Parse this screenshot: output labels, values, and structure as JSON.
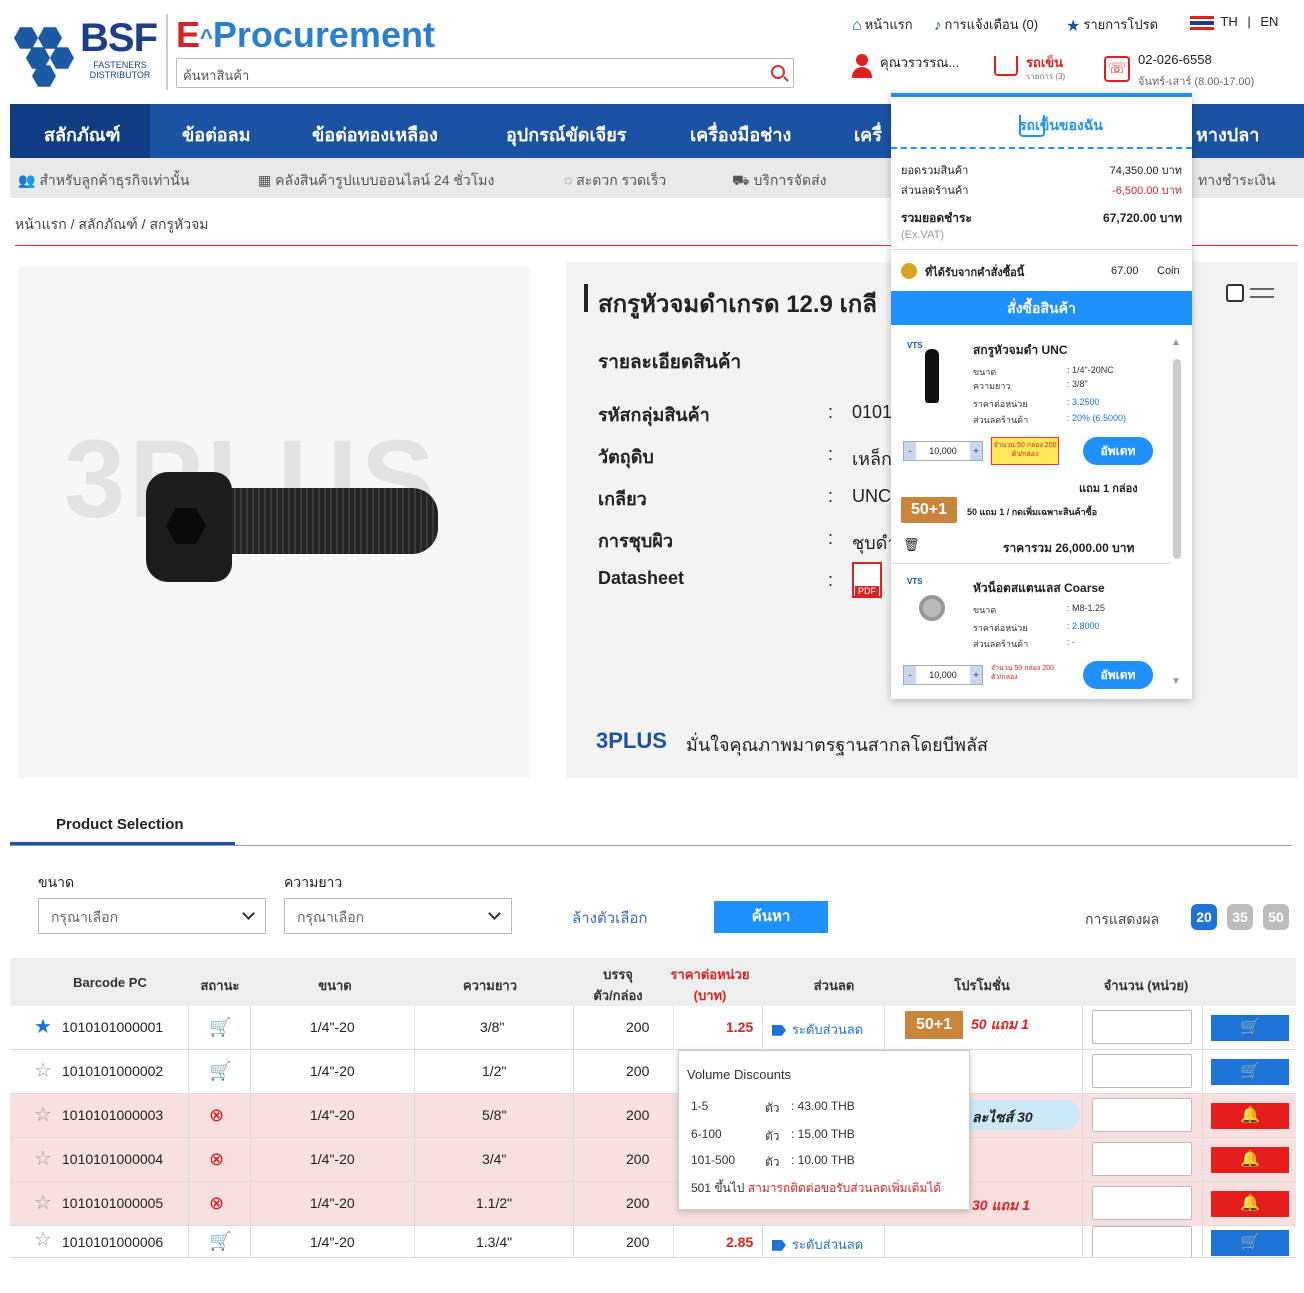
{
  "brand": {
    "logo_text": "BSF",
    "logo_sub_line1": "FASTENERS",
    "logo_sub_line2": "DISTRIBUTOR",
    "e_letter": "E",
    "procurement": "Procurement"
  },
  "search": {
    "placeholder": "ค้นหาสินค้า"
  },
  "topnav": {
    "home": "หน้าแรก",
    "notifications": "การแจ้งเตือน (0)",
    "favorites": "รายการโปรด",
    "lang_th": "TH",
    "lang_sep": "|",
    "lang_en": "EN",
    "user_name": "คุณวรวรรณ...",
    "cart_label": "รถเข็น",
    "cart_sub": "รายการ (3)",
    "phone": "02-026-6558",
    "hours": "จันทร์-เสาร์ (8.00-17.00)"
  },
  "navbar": {
    "items": [
      "สลักภัณฑ์",
      "ข้อต่อลม",
      "ข้อต่อทองเหลือง",
      "อุปกรณ์ขัดเจียร",
      "เครื่องมือช่าง",
      "เครื่",
      "หางปลา"
    ]
  },
  "subbar": {
    "items": [
      "สำหรับลูกค้าธุรกิจเท่านั้น",
      "คลังสินค้ารูปแบบออนไลน์ 24 ชั่วโมง",
      "สะดวก รวดเร็ว",
      "บริการจัดส่ง",
      "ทางชำระเงิน"
    ]
  },
  "breadcrumb": "หน้าแรก / สลักภัณฑ์ / สกรูหัวจม",
  "product": {
    "watermark": "3PLUS",
    "title": "สกรูหัวจมดำเกรด 12.9 เกลี",
    "detail_heading": "รายละเอียดสินค้า",
    "specs": [
      {
        "label": "รหัสกลุ่มสินค้า",
        "value": "0101"
      },
      {
        "label": "วัตถุดิบ",
        "value": "เหล็ก"
      },
      {
        "label": "เกลียว",
        "value": "UNC"
      },
      {
        "label": "การชุบผิว",
        "value": "ชุบดำ"
      },
      {
        "label": "Datasheet",
        "value": ""
      }
    ],
    "colon": ":",
    "bplus_logo": "3PLUS",
    "bplus_text": "มั่นใจคุณภาพมาตรฐานสากลโดยบีพลัส"
  },
  "cart_dropdown": {
    "title": "รถเข็นของฉัน",
    "subtotal_label": "ยอดรวมสินค้า",
    "subtotal_value": "74,350.00 บาท",
    "discount_label": "ส่วนลดร้านค้า",
    "discount_value": "-6,500.00 บาท",
    "total_label": "รวมยอดชำระ",
    "total_value": "67,720.00 บาท",
    "exvat": "(Ex.VAT)",
    "coin_label": "ที่ได้รับจากคำสั่งซื้อนี้",
    "coin_value": "67.00",
    "coin_unit": "Coin",
    "order_button": "สั่งซื้อสินค้า",
    "items": [
      {
        "brand": "VTS",
        "name": "สกรูหัวจมดำ UNC",
        "size_label": "ขนาด",
        "size_value": ": 1/4\"-20NC",
        "length_label": "ความยาว",
        "length_value": ": 3/8\"",
        "unit_price_label": "ราคาต่อหน่วย",
        "unit_price_value": ": 3.2500",
        "store_disc_label": "ส่วนลดร้านค้า",
        "store_disc_value": ": 20% (6.5000)",
        "qty": "10,000",
        "qty_minus": "-",
        "qty_plus": "+",
        "qty_note": "จำนวน 50 กล่อง 200 ตัว/กล่อง",
        "update_button": "อัพเดท",
        "free_text": "แถม 1 กล่อง",
        "promo_badge": "50+1",
        "promo_text": "50 แถม 1 / กดเพิ่มเฉพาะสินค้าซื้อ",
        "line_total": "ราคารวม 26,000.00 บาท"
      },
      {
        "brand": "VTS",
        "name": "หัวน็อตสแตนเลส Coarse",
        "size_label": "ขนาด",
        "size_value": ": M8-1.25",
        "unit_price_label": "ราคาต่อหน่วย",
        "unit_price_value": ": 2.8000",
        "store_disc_label": "ส่วนลดร้านค้า",
        "store_disc_value": ": -",
        "qty": "10,000",
        "qty_minus": "-",
        "qty_plus": "+",
        "qty_note": "จำนวน 50 กล่อง 200 ตัว/กล่อง",
        "update_button": "อัพเดท"
      }
    ]
  },
  "selection": {
    "tab": "Product Selection",
    "size_label": "ขนาด",
    "length_label": "ความยาว",
    "select_placeholder": "กรุณาเลือก",
    "clear": "ล้างตัวเลือก",
    "search": "ค้นหา",
    "show_label": "การแสดงผล",
    "page_sizes": [
      "20",
      "35",
      "50"
    ]
  },
  "table": {
    "headers": {
      "barcode": "Barcode PC",
      "status": "สถานะ",
      "size": "ขนาด",
      "length": "ความยาว",
      "pack_1": "บรรจุ",
      "pack_2": "ตัว/กล่อง",
      "price_1": "ราคาต่อหน่วย",
      "price_2": "(บาท)",
      "discount": "ส่วนลด",
      "promo": "โปรโมชั่น",
      "qty": "จำนวน (หน่วย)"
    },
    "rows": [
      {
        "barcode": "1010101000001",
        "size": "1/4\"-20",
        "length": "3/8\"",
        "pack": "200",
        "price": "1.25",
        "discount": "ระดับส่วนลด",
        "promo_badge": "50+1",
        "promo": "50 แถม 1"
      },
      {
        "barcode": "1010101000002",
        "size": "1/4\"-20",
        "length": "1/2\"",
        "pack": "200",
        "price": "",
        "discount": "",
        "promo_badge": "",
        "promo": ""
      },
      {
        "barcode": "1010101000003",
        "size": "1/4\"-20",
        "length": "5/8\"",
        "pack": "200",
        "price": "",
        "discount": "",
        "promo_badge": "",
        "promo": "ละไซส์ 30"
      },
      {
        "barcode": "1010101000004",
        "size": "1/4\"-20",
        "length": "3/4\"",
        "pack": "200",
        "price": "",
        "discount": "",
        "promo_badge": "",
        "promo": ""
      },
      {
        "barcode": "1010101000005",
        "size": "1/4\"-20",
        "length": "1.1/2\"",
        "pack": "200",
        "price": "",
        "discount": "",
        "promo_badge": "",
        "promo": "30 แถม 1"
      },
      {
        "barcode": "1010101000006",
        "size": "1/4\"-20",
        "length": "1.3/4\"",
        "pack": "200",
        "price": "2.85",
        "discount": "ระดับส่วนลด",
        "promo_badge": "",
        "promo": ""
      }
    ],
    "volume_popup": {
      "title": "Volume Discounts",
      "unit": "ตัว",
      "tiers": [
        {
          "range": "1-5",
          "price": ": 43.00 THB"
        },
        {
          "range": "6-100",
          "price": ": 15.00 THB"
        },
        {
          "range": "101-500",
          "price": ": 10.00 THB"
        }
      ],
      "note_prefix": "501 ขึ้นไป",
      "note_link": "สามารถติดต่อขอรับส่วนลดเพิ่มเติมได้"
    }
  },
  "colors": {
    "primary": "#1b52a3",
    "accent": "#1e90ff",
    "danger": "#e51c1c",
    "brand_red": "#d62424"
  }
}
